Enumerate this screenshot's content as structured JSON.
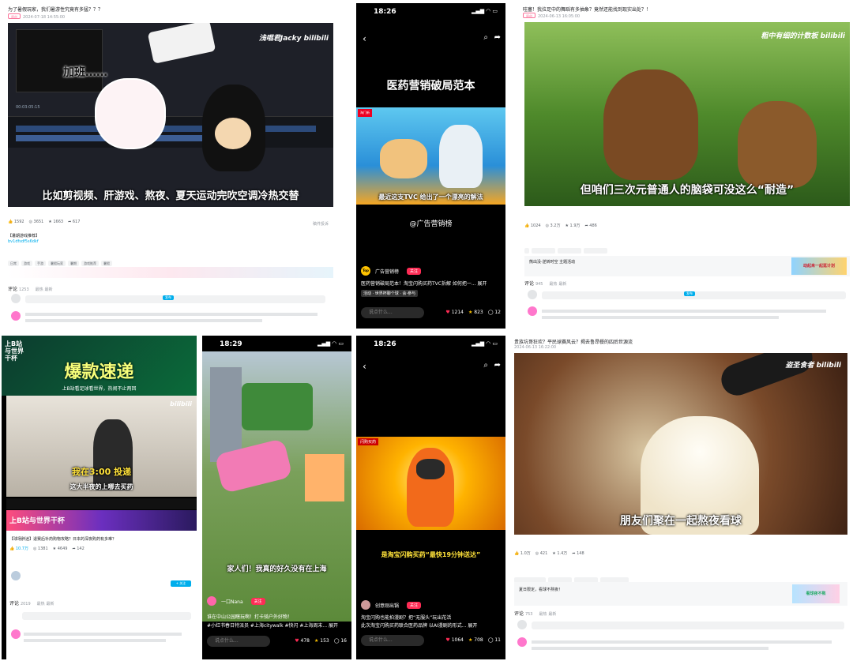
{
  "p1": {
    "title": "为了暑假玩家，我们暑游性究竟有多猛？？？",
    "meta": "2024-07-18 14:55:00",
    "watermark": "浅唱君Jacky",
    "logo": "bilibili",
    "caption_bubble": "加班……",
    "subtitle": "比如剪视频、肝游戏、熬夜、夏天运动完吹空调冷热交替",
    "timecode": "00:03:05:15",
    "stats": [
      "1592",
      "3651",
      "1663",
      "617"
    ],
    "share": "稿件投诉",
    "tags": [
      "日常",
      "游戏",
      "手游",
      "暑假玩家",
      "暑期",
      "游戏推荐",
      "暑假",
      "日常",
      "游戏",
      "暑期",
      "话题"
    ],
    "desc": "【暑期游戏推荐】",
    "link1": "bv1dfsdf5s6dkf",
    "comment_label": "评论",
    "comment_count": "1253",
    "hot": "最热",
    "new": "最新",
    "send": "发布"
  },
  "p2": {
    "time": "18:26",
    "headline": "医药营销破局范本",
    "tag": "淘门新",
    "logo_badge": "Top",
    "caption": "最近这支TVC 给出了一个漂亮的解法",
    "account": "@广告营销榜",
    "author": "广告营销榜",
    "follow": "关注",
    "desc": "医药营销破局范本！淘宝闪购买药TVC拆解 如何把一... 展开",
    "topic": "活动 · 世界杯聊个球 · 会·参与",
    "input": "说点什么...",
    "likes": "1214",
    "stars": "823",
    "comments": "12"
  },
  "p3": {
    "title": "哇塞！我拉足中的舞蹈有多抽象？竟然还能找到现实出处？！",
    "meta": "2024-06-13 16:05:00",
    "watermark": "粗中有细的计数板",
    "logo": "bilibili",
    "subtitle": "但咱们三次元普通人的脑袋可没这么“耐造”",
    "stats": [
      "1024",
      "3.2万",
      "1.9万",
      "486"
    ],
    "comment_label": "评论",
    "comment_count": "945",
    "hot": "最热",
    "new": "最新",
    "send": "发布",
    "ad_title": "熊出没·逆转时空 主题活动",
    "ad_banner": "动起来一起逛计划"
  },
  "p4": {
    "corner_title": "上B站与世界干杯",
    "banner": "爆款速递",
    "banner_sub": "上B站看足球看世界，热闹不止两回",
    "subtitle_top": "我在3:00 投递",
    "subtitle": "这大半夜的上哪去买药",
    "logo": "bilibili",
    "event_title": "上B站与世界干杯",
    "video_title": "【球场胖迷】退赛后补药购物攻略？日本的深夜购药有多难？",
    "stats": [
      "10.7万",
      "1381",
      "4649",
      "142"
    ],
    "follow": "+ 关注",
    "comment_label": "评论",
    "comment_count": "2019",
    "hot": "最热",
    "new": "最新"
  },
  "p5": {
    "time": "18:29",
    "caption": "家人们！我真的好久没有在上海",
    "author": "一口Nana",
    "follow": "关注",
    "desc": "谁在中山公园瞎玩啊！打卡骑户外好物！",
    "topics": "#小红书春日特派员 #上海citywalk #快闪 #上海周末... 展开",
    "input": "说点什么...",
    "likes": "478",
    "stars": "153",
    "comments": "16"
  },
  "p6": {
    "time": "18:26",
    "top_tag": "闪购买药",
    "headline": "是淘宝闪购买药“最快19分钟送达”",
    "author": "创意刚出锅",
    "follow": "关注",
    "desc": "淘宝闪购也能拍漫剧？把“无服头”玩出花活",
    "desc2": "此次淘宝闪购买药联合医药品牌 以AI漫剧的形式... 展开",
    "input": "说点什么...",
    "likes": "1064",
    "stars": "708",
    "comments": "11"
  },
  "p7": {
    "title": "贵族坑哥狂欢？平民球赛风云？揭去鲁昂餐的四后世源流",
    "meta": "2024-06-13 16:22:00",
    "watermark": "盗圣食者",
    "logo": "bilibili",
    "subtitle": "朋友们聚在一起熬夜看球",
    "stats": [
      "1.0万",
      "421",
      "1.4万",
      "148"
    ],
    "comment_label": "评论",
    "comment_count": "753",
    "hot": "最热",
    "new": "最新",
    "ad_title": "夏日限定，看球不熬夜！",
    "ad_banner": "看球夜不熬"
  },
  "colors": {
    "bili_pink": "#fb7299",
    "bili_blue": "#00aeec",
    "douyin_red": "#fe2c55",
    "gold": "#ffc300"
  }
}
